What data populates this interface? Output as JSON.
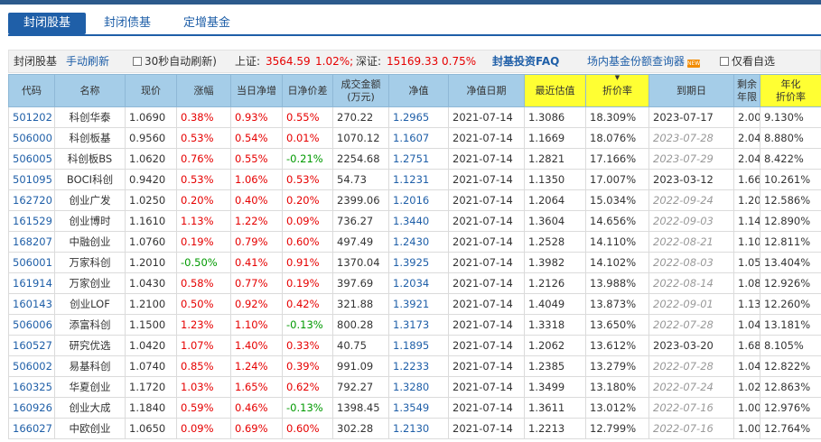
{
  "tabs": [
    {
      "label": "封闭股基",
      "active": true
    },
    {
      "label": "封闭债基",
      "active": false
    },
    {
      "label": "定增基金",
      "active": false
    }
  ],
  "toolbar": {
    "section_title": "封闭股基",
    "refresh_link": "手动刷新",
    "auto_refresh_label": "30秒自动刷新)",
    "sh_label": "上证:",
    "sh_value": "3564.59",
    "sh_change": "1.02%;",
    "sz_label": "深证:",
    "sz_value": "15169.33",
    "sz_change": "0.75%",
    "faq_link": "封基投资FAQ",
    "query_link": "场内基金份额查询器",
    "new_badge": "NEW",
    "only_selected_label": "仅看自选"
  },
  "table": {
    "headers": [
      "代码",
      "名称",
      "现价",
      "涨幅",
      "当日净增",
      "日净价差",
      "成交金额\n(万元)",
      "净值",
      "净值日期",
      "最近估值",
      "折价率",
      "到期日",
      "剩余\n年限",
      "年化\n折价率"
    ],
    "rows": [
      {
        "code": "501202",
        "name": "科创华泰",
        "price": "1.0690",
        "chg": "0.38%",
        "chg_color": "red",
        "nav_inc": "0.93%",
        "nav_inc_color": "red",
        "spread": "0.55%",
        "spread_color": "red",
        "amount": "270.22",
        "nav": "1.2965",
        "nav_date": "2021-07-14",
        "est": "1.3086",
        "disc": "18.309%",
        "due": "2023-07-17",
        "due_italic": false,
        "years": "2.00",
        "annual": "9.130%"
      },
      {
        "code": "506000",
        "name": "科创板基",
        "price": "0.9560",
        "chg": "0.53%",
        "chg_color": "red",
        "nav_inc": "0.54%",
        "nav_inc_color": "red",
        "spread": "0.01%",
        "spread_color": "red",
        "amount": "1070.12",
        "nav": "1.1607",
        "nav_date": "2021-07-14",
        "est": "1.1669",
        "disc": "18.076%",
        "due": "2023-07-28",
        "due_italic": true,
        "years": "2.04",
        "annual": "8.880%"
      },
      {
        "code": "506005",
        "name": "科创板BS",
        "price": "1.0620",
        "chg": "0.76%",
        "chg_color": "red",
        "nav_inc": "0.55%",
        "nav_inc_color": "red",
        "spread": "-0.21%",
        "spread_color": "green",
        "amount": "2254.68",
        "nav": "1.2751",
        "nav_date": "2021-07-14",
        "est": "1.2821",
        "disc": "17.166%",
        "due": "2023-07-29",
        "due_italic": true,
        "years": "2.04",
        "annual": "8.422%"
      },
      {
        "code": "501095",
        "name": "BOCI科创",
        "price": "0.9420",
        "chg": "0.53%",
        "chg_color": "red",
        "nav_inc": "1.06%",
        "nav_inc_color": "red",
        "spread": "0.53%",
        "spread_color": "red",
        "amount": "54.73",
        "nav": "1.1231",
        "nav_date": "2021-07-14",
        "est": "1.1350",
        "disc": "17.007%",
        "due": "2023-03-12",
        "due_italic": false,
        "years": "1.66",
        "annual": "10.261%"
      },
      {
        "code": "162720",
        "name": "创业广发",
        "price": "1.0250",
        "chg": "0.20%",
        "chg_color": "red",
        "nav_inc": "0.40%",
        "nav_inc_color": "red",
        "spread": "0.20%",
        "spread_color": "red",
        "amount": "2399.06",
        "nav": "1.2016",
        "nav_date": "2021-07-14",
        "est": "1.2064",
        "disc": "15.034%",
        "due": "2022-09-24",
        "due_italic": true,
        "years": "1.20",
        "annual": "12.586%"
      },
      {
        "code": "161529",
        "name": "创业博时",
        "price": "1.1610",
        "chg": "1.13%",
        "chg_color": "red",
        "nav_inc": "1.22%",
        "nav_inc_color": "red",
        "spread": "0.09%",
        "spread_color": "red",
        "amount": "736.27",
        "nav": "1.3440",
        "nav_date": "2021-07-14",
        "est": "1.3604",
        "disc": "14.656%",
        "due": "2022-09-03",
        "due_italic": true,
        "years": "1.14",
        "annual": "12.890%"
      },
      {
        "code": "168207",
        "name": "中融创业",
        "price": "1.0760",
        "chg": "0.19%",
        "chg_color": "red",
        "nav_inc": "0.79%",
        "nav_inc_color": "red",
        "spread": "0.60%",
        "spread_color": "red",
        "amount": "497.49",
        "nav": "1.2430",
        "nav_date": "2021-07-14",
        "est": "1.2528",
        "disc": "14.110%",
        "due": "2022-08-21",
        "due_italic": true,
        "years": "1.10",
        "annual": "12.811%"
      },
      {
        "code": "506001",
        "name": "万家科创",
        "price": "1.2010",
        "chg": "-0.50%",
        "chg_color": "green",
        "nav_inc": "0.41%",
        "nav_inc_color": "red",
        "spread": "0.91%",
        "spread_color": "red",
        "amount": "1370.04",
        "nav": "1.3925",
        "nav_date": "2021-07-14",
        "est": "1.3982",
        "disc": "14.102%",
        "due": "2022-08-03",
        "due_italic": true,
        "years": "1.05",
        "annual": "13.404%"
      },
      {
        "code": "161914",
        "name": "万家创业",
        "price": "1.0430",
        "chg": "0.58%",
        "chg_color": "red",
        "nav_inc": "0.77%",
        "nav_inc_color": "red",
        "spread": "0.19%",
        "spread_color": "red",
        "amount": "397.69",
        "nav": "1.2034",
        "nav_date": "2021-07-14",
        "est": "1.2126",
        "disc": "13.988%",
        "due": "2022-08-14",
        "due_italic": true,
        "years": "1.08",
        "annual": "12.926%"
      },
      {
        "code": "160143",
        "name": "创业LOF",
        "price": "1.2100",
        "chg": "0.50%",
        "chg_color": "red",
        "nav_inc": "0.92%",
        "nav_inc_color": "red",
        "spread": "0.42%",
        "spread_color": "red",
        "amount": "321.88",
        "nav": "1.3921",
        "nav_date": "2021-07-14",
        "est": "1.4049",
        "disc": "13.873%",
        "due": "2022-09-01",
        "due_italic": true,
        "years": "1.13",
        "annual": "12.260%"
      },
      {
        "code": "506006",
        "name": "添富科创",
        "price": "1.1500",
        "chg": "1.23%",
        "chg_color": "red",
        "nav_inc": "1.10%",
        "nav_inc_color": "red",
        "spread": "-0.13%",
        "spread_color": "green",
        "amount": "800.28",
        "nav": "1.3173",
        "nav_date": "2021-07-14",
        "est": "1.3318",
        "disc": "13.650%",
        "due": "2022-07-28",
        "due_italic": true,
        "years": "1.04",
        "annual": "13.181%"
      },
      {
        "code": "160527",
        "name": "研究优选",
        "price": "1.0420",
        "chg": "1.07%",
        "chg_color": "red",
        "nav_inc": "1.40%",
        "nav_inc_color": "red",
        "spread": "0.33%",
        "spread_color": "red",
        "amount": "40.75",
        "nav": "1.1895",
        "nav_date": "2021-07-14",
        "est": "1.2062",
        "disc": "13.612%",
        "due": "2023-03-20",
        "due_italic": false,
        "years": "1.68",
        "annual": "8.105%"
      },
      {
        "code": "506002",
        "name": "易基科创",
        "price": "1.0740",
        "chg": "0.85%",
        "chg_color": "red",
        "nav_inc": "1.24%",
        "nav_inc_color": "red",
        "spread": "0.39%",
        "spread_color": "red",
        "amount": "991.09",
        "nav": "1.2233",
        "nav_date": "2021-07-14",
        "est": "1.2385",
        "disc": "13.279%",
        "due": "2022-07-28",
        "due_italic": true,
        "years": "1.04",
        "annual": "12.822%"
      },
      {
        "code": "160325",
        "name": "华夏创业",
        "price": "1.1720",
        "chg": "1.03%",
        "chg_color": "red",
        "nav_inc": "1.65%",
        "nav_inc_color": "red",
        "spread": "0.62%",
        "spread_color": "red",
        "amount": "792.27",
        "nav": "1.3280",
        "nav_date": "2021-07-14",
        "est": "1.3499",
        "disc": "13.180%",
        "due": "2022-07-24",
        "due_italic": true,
        "years": "1.02",
        "annual": "12.863%"
      },
      {
        "code": "160926",
        "name": "创业大成",
        "price": "1.1840",
        "chg": "0.59%",
        "chg_color": "red",
        "nav_inc": "0.46%",
        "nav_inc_color": "red",
        "spread": "-0.13%",
        "spread_color": "green",
        "amount": "1398.45",
        "nav": "1.3549",
        "nav_date": "2021-07-14",
        "est": "1.3611",
        "disc": "13.012%",
        "due": "2022-07-16",
        "due_italic": true,
        "years": "1.00",
        "annual": "12.976%"
      },
      {
        "code": "166027",
        "name": "中欧创业",
        "price": "1.0650",
        "chg": "0.09%",
        "chg_color": "red",
        "nav_inc": "0.69%",
        "nav_inc_color": "red",
        "spread": "0.60%",
        "spread_color": "red",
        "amount": "302.28",
        "nav": "1.2130",
        "nav_date": "2021-07-14",
        "est": "1.2213",
        "disc": "12.799%",
        "due": "2022-07-16",
        "due_italic": true,
        "years": "1.00",
        "annual": "12.764%"
      }
    ]
  }
}
